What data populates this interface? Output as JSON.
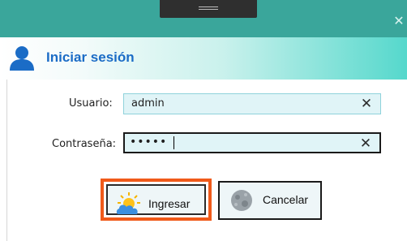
{
  "window": {
    "close_icon": "close-icon"
  },
  "header": {
    "icon": "user-icon",
    "title": "Iniciar sesión"
  },
  "form": {
    "username": {
      "label": "Usuario:",
      "value": "admin",
      "clear_icon": "clear-icon"
    },
    "password": {
      "label": "Contraseña:",
      "masked_value": "•••••",
      "clear_icon": "clear-icon"
    }
  },
  "buttons": {
    "login": {
      "label": "Ingresar",
      "icon": "sun-cloud-icon"
    },
    "cancel": {
      "label": "Cancelar",
      "icon": "moon-icon"
    }
  },
  "colors": {
    "titlebar": "#3aa69b",
    "header_accent": "#55d8cc",
    "title_text": "#1b6cc6",
    "field_bg": "#e0f4f7",
    "focus_border": "#f05a1a"
  }
}
